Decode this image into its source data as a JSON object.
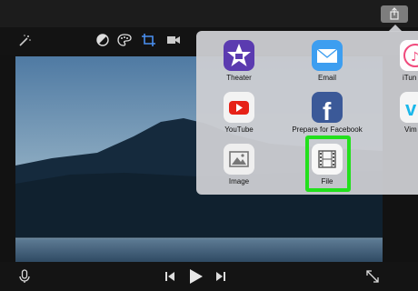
{
  "share_items": [
    {
      "label": "Theater",
      "icon": "theater-star-icon"
    },
    {
      "label": "Email",
      "icon": "envelope-icon"
    },
    {
      "label": "iTun",
      "icon": "itunes-icon"
    },
    {
      "label": "YouTube",
      "icon": "youtube-icon"
    },
    {
      "label": "Prepare for Facebook",
      "icon": "facebook-icon"
    },
    {
      "label": "Vim",
      "icon": "vimeo-icon"
    },
    {
      "label": "Image",
      "icon": "image-icon"
    },
    {
      "label": "File",
      "icon": "film-file-icon"
    }
  ],
  "highlight_color": "#22e01c",
  "colors": {
    "theater": "#5b3bb0",
    "email": "#3d9ef0",
    "youtube": "#e62117",
    "facebook": "#3b5998",
    "itunes": "#f04a7c",
    "vimeo": "#1ab7ea"
  }
}
